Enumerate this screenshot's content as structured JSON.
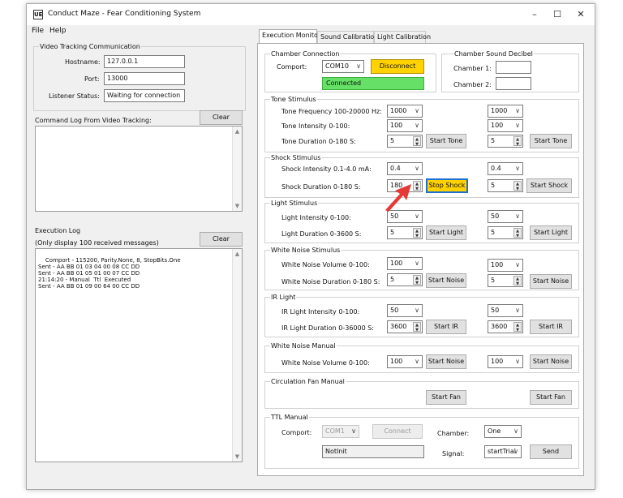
{
  "window": {
    "title": "Conduct Maze - Fear Conditioning System",
    "app_icon_text": "UE",
    "minimize": "–",
    "maximize": "☐",
    "close": "✕"
  },
  "menu": [
    "File",
    "Help"
  ],
  "video_tracking": {
    "group_label": "Video Tracking Communication",
    "hostname_label": "Hostname:",
    "hostname": "127.0.0.1",
    "port_label": "Port:",
    "port": "13000",
    "listener_label": "Listener Status:",
    "listener_status": "Waiting for connection"
  },
  "command_log": {
    "label": "Command Log From Video Tracking:",
    "clear": "Clear",
    "text": ""
  },
  "execution_log": {
    "label": "Execution Log",
    "sublabel": "(Only display 100 received messages)",
    "clear": "Clear",
    "lines": "Comport - 115200, Parity.None, 8, StopBits.One\nSent - AA BB 01 03 04 00 08 CC DD\nSent - AA BB 01 05 01 00 07 CC DD\n21:14:20 - Manual  Ttl  Executed\nSent - AA BB 01 09 00 64 00 CC DD"
  },
  "tabs": [
    "Execution Monitor",
    "Sound Calibration",
    "Light Calibration"
  ],
  "chamber_connection": {
    "label": "Chamber Connection",
    "comport_label": "Comport:",
    "comport": "COM10",
    "disconnect": "Disconnect",
    "status": "Connected"
  },
  "sound_decibel": {
    "label": "Chamber Sound Decibel",
    "chamber1": "Chamber 1:",
    "chamber2": "Chamber 2:"
  },
  "tone": {
    "label": "Tone Stimulus",
    "freq_label": "Tone Frequency 100-20000 Hz:",
    "freq1": "1000",
    "freq2": "1000",
    "int_label": "Tone Intensity 0-100:",
    "int1": "100",
    "int2": "100",
    "dur_label": "Tone Duration 0-180 S:",
    "dur1": "5",
    "dur2": "5",
    "start": "Start Tone"
  },
  "shock": {
    "label": "Shock Stimulus",
    "int_label": "Shock Intensity 0.1-4.0 mA:",
    "int1": "0.4",
    "int2": "0.4",
    "dur_label": "Shock Duration 0-180 S:",
    "dur1": "180",
    "dur2": "5",
    "stop": "Stop Shock",
    "start": "Start Shock"
  },
  "light": {
    "label": "Light Stimulus",
    "int_label": "Light Intensity 0-100:",
    "int1": "50",
    "int2": "50",
    "dur_label": "Light Duration 0-3600 S:",
    "dur1": "5",
    "dur2": "5",
    "start": "Start Light"
  },
  "white_noise": {
    "label": "White Noise Stimulus",
    "vol_label": "White Noise Volume 0-100:",
    "vol1": "100",
    "vol2": "100",
    "dur_label": "White Noise Duration 0-180 S:",
    "dur1": "5",
    "dur2": "5",
    "start": "Start Noise"
  },
  "ir_light": {
    "label": "IR Light",
    "int_label": "IR Light Intensity 0-100:",
    "int1": "50",
    "int2": "50",
    "dur_label": "IR Light Duration 0-36000 S:",
    "dur1": "3600",
    "dur2": "3600",
    "start": "Start IR"
  },
  "white_noise_manual": {
    "label": "White Noise Manual",
    "vol_label": "White Noise Volume 0-100:",
    "vol1": "100",
    "vol2": "100",
    "start": "Start Noise"
  },
  "fan": {
    "label": "Circulation Fan Manual",
    "start": "Start Fan"
  },
  "ttl": {
    "label": "TTL Manual",
    "comport_label": "Comport:",
    "comport": "COM1",
    "connect": "Connect",
    "chamber_label": "Chamber:",
    "chamber": "One",
    "status": "NotInit",
    "signal_label": "Signal:",
    "signal": "startTrial",
    "send": "Send"
  },
  "colors": {
    "accent_yellow": "#ffd200",
    "connected_green": "#66e066",
    "focus_blue": "#1e6fd0",
    "arrow_red": "#e53935"
  }
}
